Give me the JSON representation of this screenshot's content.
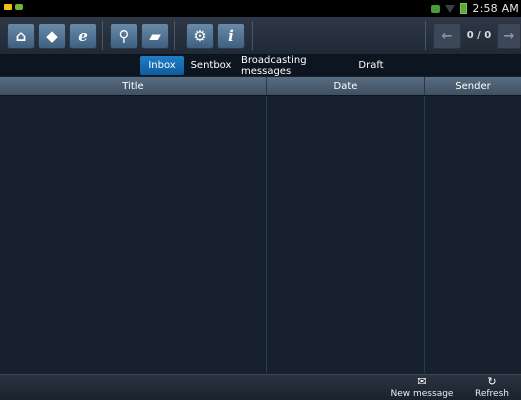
{
  "status_bar": {
    "time": "2:58 AM"
  },
  "toolbar": {
    "buttons": [
      {
        "icon": "home-icon",
        "glyph": "⌂"
      },
      {
        "icon": "tag-icon",
        "glyph": "◆"
      },
      {
        "icon": "browser-e-icon",
        "glyph": "e"
      },
      {
        "icon": "antenna-icon",
        "glyph": "⚲"
      },
      {
        "icon": "chat-bubble-icon",
        "glyph": "▰"
      },
      {
        "icon": "gear-icon",
        "glyph": "⚙"
      },
      {
        "icon": "info-icon",
        "glyph": "i"
      }
    ],
    "prev_glyph": "←",
    "next_glyph": "→",
    "page_indicator": "0 / 0"
  },
  "tabs": [
    {
      "label": "Inbox",
      "active": true
    },
    {
      "label": "Sentbox",
      "active": false
    },
    {
      "label": "Broadcasting messages",
      "active": false
    },
    {
      "label": "Draft",
      "active": false
    }
  ],
  "table": {
    "columns": [
      "Title",
      "Date",
      "Sender"
    ],
    "rows": []
  },
  "bottom_bar": {
    "new_message_label": "New message",
    "new_message_icon": "envelope-icon",
    "refresh_label": "Refresh",
    "refresh_icon": "refresh-icon"
  },
  "colors": {
    "accent_tab": "#1f7ec9",
    "background": "#17212d"
  }
}
